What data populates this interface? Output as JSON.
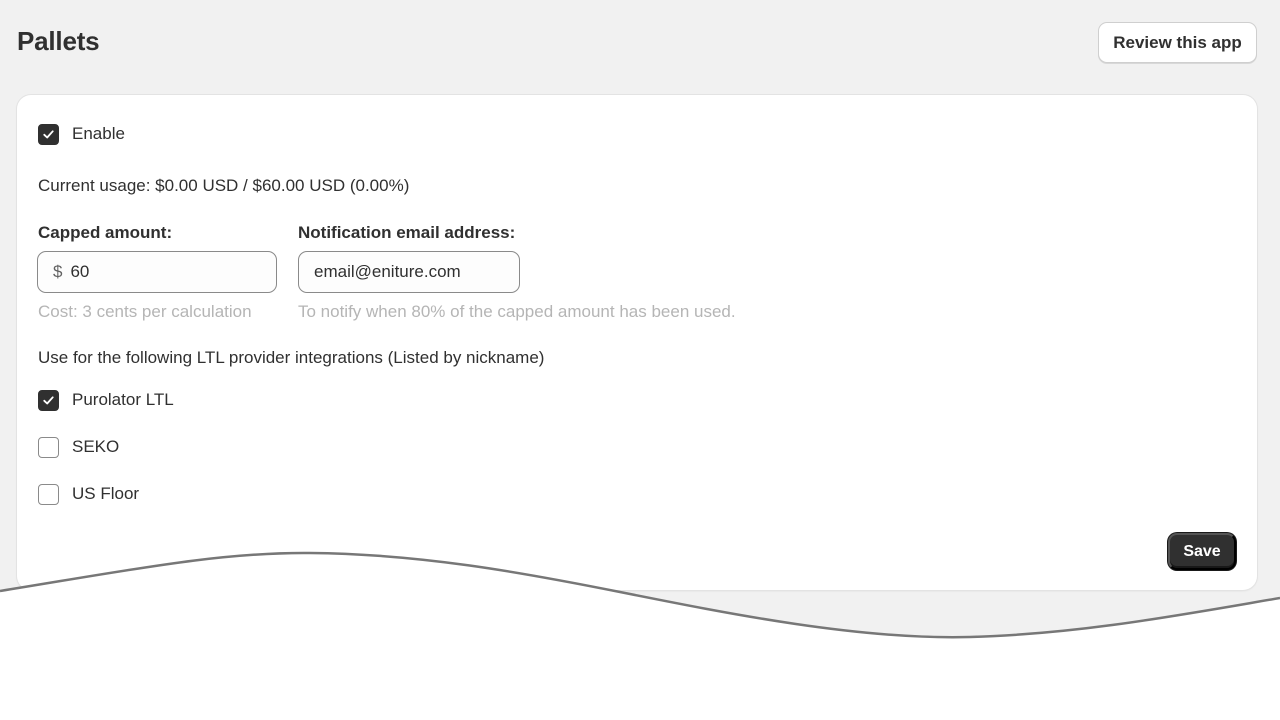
{
  "header": {
    "title": "Pallets",
    "review_button_label": "Review this app"
  },
  "settings": {
    "enable_label": "Enable",
    "enable_checked": true,
    "usage_text": "Current usage: $0.00 USD / $60.00 USD (0.00%)",
    "capped_amount": {
      "label": "Capped amount:",
      "prefix": "$",
      "value": "60",
      "help": "Cost: 3 cents per calculation"
    },
    "notification_email": {
      "label": "Notification email address:",
      "value": "email@eniture.com",
      "help": "To notify when 80% of the capped amount has been used."
    },
    "integrations_title": "Use for the following LTL provider integrations (Listed by nickname)",
    "integrations": [
      {
        "label": "Purolator LTL",
        "checked": true
      },
      {
        "label": "SEKO",
        "checked": false
      },
      {
        "label": "US Floor",
        "checked": false
      }
    ],
    "save_label": "Save"
  },
  "colors": {
    "background": "#f1f1f1",
    "card": "#ffffff",
    "primary_button": "#303030",
    "help_text": "#b5b5b5"
  }
}
